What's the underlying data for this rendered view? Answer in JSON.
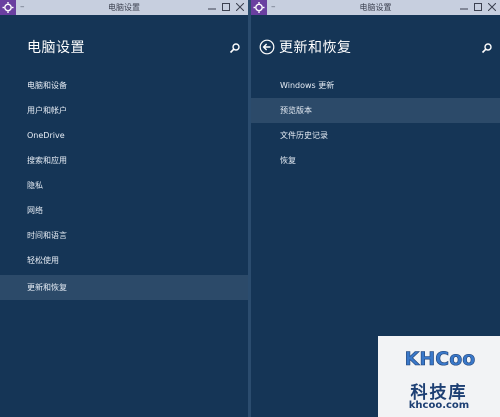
{
  "colors": {
    "background": "#153556",
    "selected_row": "#2c4a69",
    "titlebar": "#c7cfdf",
    "app_icon": "#6a3fa0",
    "text": "#e8eef6"
  },
  "left_window": {
    "title": "电脑设置",
    "minimize_label": "–",
    "heading": "电脑设置",
    "search_icon": "search-icon",
    "items": [
      {
        "label": "电脑和设备"
      },
      {
        "label": "用户和帐户"
      },
      {
        "label": "OneDrive"
      },
      {
        "label": "搜索和应用"
      },
      {
        "label": "隐私"
      },
      {
        "label": "网络"
      },
      {
        "label": "时间和语言"
      },
      {
        "label": "轻松使用"
      },
      {
        "label": "更新和恢复",
        "selected": true
      }
    ]
  },
  "right_window": {
    "title": "电脑设置",
    "minimize_label": "–",
    "heading": "更新和恢复",
    "back_icon": "back-arrow-icon",
    "search_icon": "search-icon",
    "items": [
      {
        "label": "Windows 更新"
      },
      {
        "label": "预览版本",
        "selected": true
      },
      {
        "label": "文件历史记录"
      },
      {
        "label": "恢复"
      }
    ]
  },
  "watermark": {
    "logo": "KHCoo",
    "name": "科技库",
    "url": "khcoo.com"
  }
}
